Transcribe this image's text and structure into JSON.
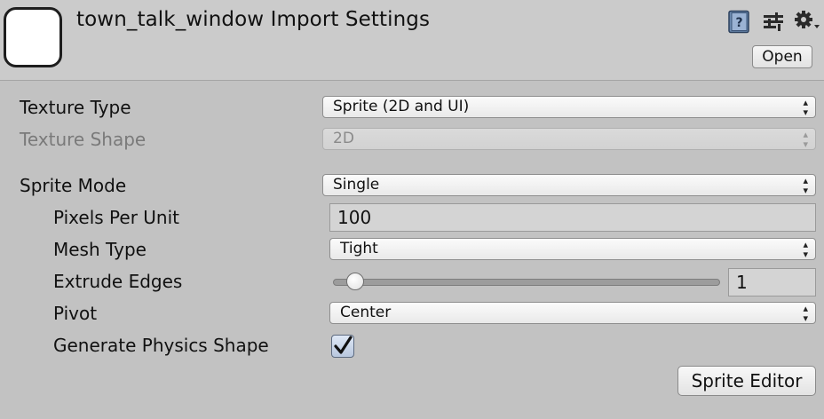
{
  "header": {
    "title": "town_talk_window Import Settings",
    "open_label": "Open",
    "icons": [
      "help-book-icon",
      "preset-sliders-icon",
      "gear-menu-icon"
    ]
  },
  "settings": {
    "texture_type": {
      "label": "Texture Type",
      "value": "Sprite (2D and UI)"
    },
    "texture_shape": {
      "label": "Texture Shape",
      "value": "2D"
    },
    "sprite_mode": {
      "label": "Sprite Mode",
      "value": "Single"
    },
    "pixels_per_unit": {
      "label": "Pixels Per Unit",
      "value": "100"
    },
    "mesh_type": {
      "label": "Mesh Type",
      "value": "Tight"
    },
    "extrude_edges": {
      "label": "Extrude Edges",
      "value": "1",
      "slider_fraction": 0.04
    },
    "pivot": {
      "label": "Pivot",
      "value": "Center"
    },
    "generate_physics_shape": {
      "label": "Generate Physics Shape",
      "checked": true
    }
  },
  "sprite_editor_label": "Sprite Editor",
  "colors": {
    "panel_bg": "#c2c2c2",
    "header_bg": "#cbcbcb",
    "check_fill": "#b8c7de"
  }
}
